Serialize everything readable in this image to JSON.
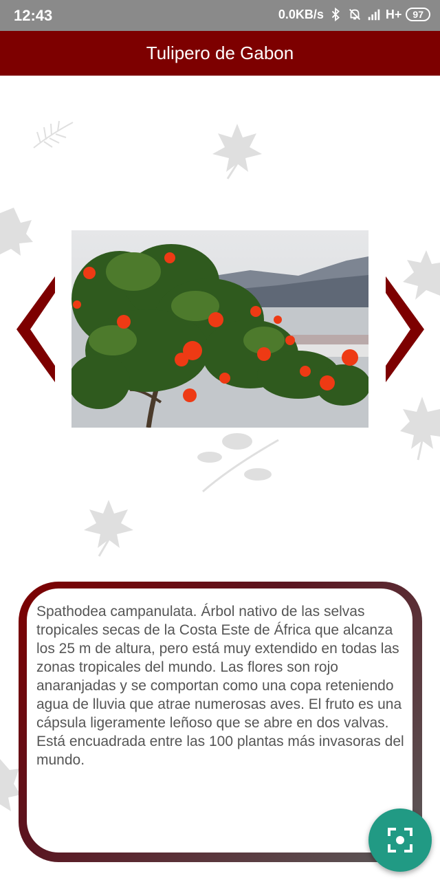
{
  "status_bar": {
    "time": "12:43",
    "network_speed": "0.0KB/s",
    "network_type": "H+",
    "battery": "97",
    "icons": [
      "bluetooth-icon",
      "mute-bell-icon",
      "signal-icon"
    ]
  },
  "app_bar": {
    "title": "Tulipero de Gabon",
    "color": "#7d0000"
  },
  "gallery": {
    "prev_icon": "chevron-left-icon",
    "next_icon": "chevron-right-icon",
    "image_subject": "flowering tree with red-orange flowers by the water"
  },
  "description": {
    "text": "Spathodea campanulata. Árbol nativo de las selvas tropicales secas de la Costa Este de África que alcanza los 25 m de altura, pero está muy extendido en todas las zonas tropicales del mundo. Las flores son rojo anaranjadas y se comportan como una copa reteniendo agua de lluvia que atrae numerosas aves. El fruto es una cápsula ligeramente leñoso que se abre en dos valvas. Está encuadrada entre las 100 plantas más invasoras del mundo."
  },
  "fab": {
    "icon": "scan-icon",
    "color": "#219a84"
  }
}
